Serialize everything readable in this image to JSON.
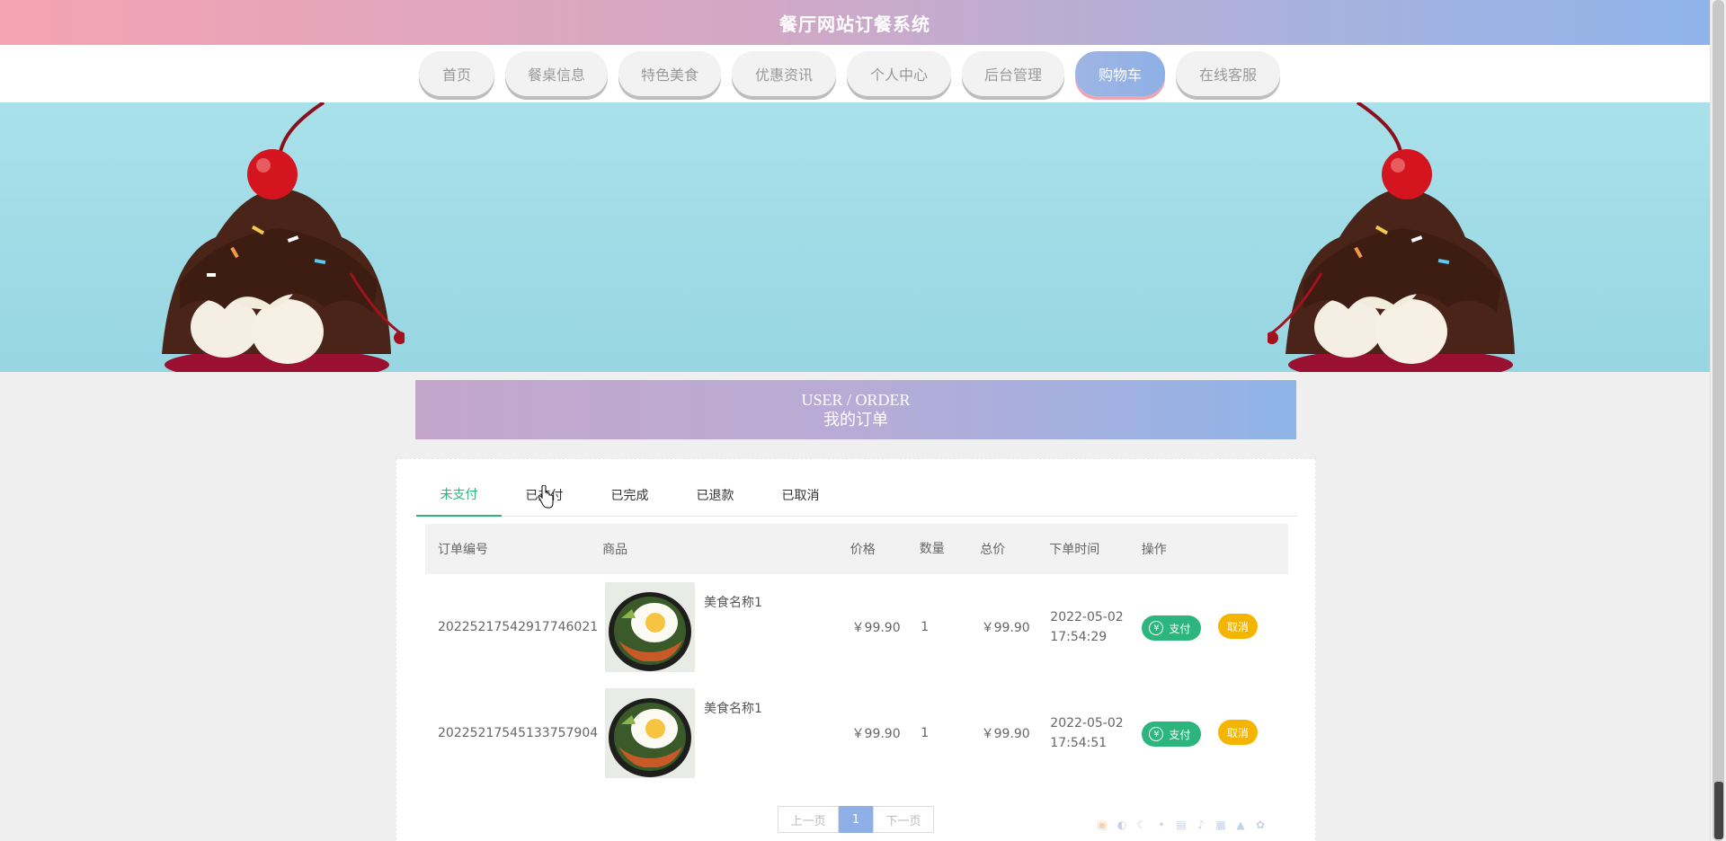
{
  "header": {
    "title": "餐厅网站订餐系统"
  },
  "nav": {
    "items": [
      {
        "label": "首页",
        "active": false
      },
      {
        "label": "餐桌信息",
        "active": false
      },
      {
        "label": "特色美食",
        "active": false
      },
      {
        "label": "优惠资讯",
        "active": false
      },
      {
        "label": "个人中心",
        "active": false
      },
      {
        "label": "后台管理",
        "active": false
      },
      {
        "label": "购物车",
        "active": true
      },
      {
        "label": "在线客服",
        "active": false
      }
    ]
  },
  "section": {
    "title_en": "USER / ORDER",
    "title_cn": "我的订单"
  },
  "tabs": [
    {
      "label": "未支付",
      "active": true
    },
    {
      "label": "已支付",
      "active": false
    },
    {
      "label": "已完成",
      "active": false
    },
    {
      "label": "已退款",
      "active": false
    },
    {
      "label": "已取消",
      "active": false
    }
  ],
  "table": {
    "headers": {
      "order_no": "订单编号",
      "goods": "商品",
      "price": "价格",
      "qty": "数量",
      "total": "总价",
      "time": "下单时间",
      "op": "操作"
    },
    "rows": [
      {
        "order_no": "20225217542917746021",
        "goods_name": "美食名称1",
        "price": "￥99.90",
        "qty": "1",
        "total": "￥99.90",
        "date": "2022-05-02",
        "time": "17:54:29",
        "pay_label": "支付",
        "cancel_label": "取消"
      },
      {
        "order_no": "20225217545133757904",
        "goods_name": "美食名称1",
        "price": "￥99.90",
        "qty": "1",
        "total": "￥99.90",
        "date": "2022-05-02",
        "time": "17:54:51",
        "pay_label": "支付",
        "cancel_label": "取消"
      }
    ]
  },
  "pagination": {
    "prev": "上一页",
    "current": "1",
    "next": "下一页"
  },
  "colors": {
    "accent_green": "#2db57e",
    "cancel_yellow": "#f4b400",
    "nav_active": "#8eb0e6"
  }
}
